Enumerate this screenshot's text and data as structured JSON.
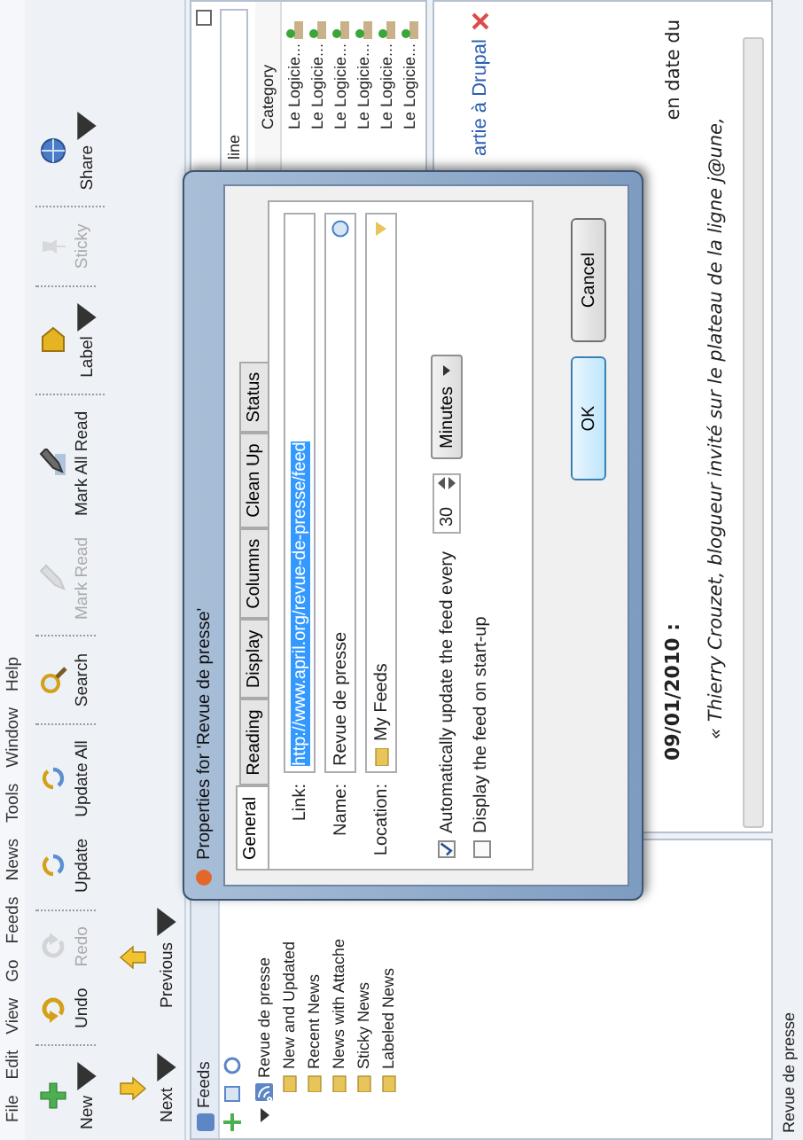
{
  "menu": [
    "File",
    "Edit",
    "View",
    "Go",
    "Feeds",
    "News",
    "Tools",
    "Window",
    "Help"
  ],
  "toolbar": {
    "items": [
      {
        "label": "New",
        "disabled": false,
        "dropdown": true,
        "separator_before": false
      },
      {
        "label": "Undo",
        "disabled": false,
        "dropdown": false,
        "separator_before": true
      },
      {
        "label": "Redo",
        "disabled": true,
        "dropdown": false,
        "separator_before": false
      },
      {
        "label": "Update",
        "disabled": false,
        "dropdown": false,
        "separator_before": true
      },
      {
        "label": "Update All",
        "disabled": false,
        "dropdown": false,
        "separator_before": false
      },
      {
        "label": "Search",
        "disabled": false,
        "dropdown": false,
        "separator_before": true
      },
      {
        "label": "Mark Read",
        "disabled": true,
        "dropdown": false,
        "separator_before": true
      },
      {
        "label": "Mark All Read",
        "disabled": false,
        "dropdown": false,
        "separator_before": false
      },
      {
        "label": "Label",
        "disabled": false,
        "dropdown": true,
        "separator_before": true
      },
      {
        "label": "Sticky",
        "disabled": true,
        "dropdown": false,
        "separator_before": true
      },
      {
        "label": "Share",
        "disabled": false,
        "dropdown": true,
        "separator_before": true
      }
    ],
    "navigation": [
      {
        "label": "Next",
        "dropdown": true
      },
      {
        "label": "Previous",
        "dropdown": true
      }
    ]
  },
  "feeds_panel": {
    "title": "Feeds",
    "tree": [
      {
        "label": "Revue de presse",
        "expanded": true,
        "children": [
          {
            "label": "New and Updated"
          },
          {
            "label": "Recent News"
          },
          {
            "label": "News with Attache"
          },
          {
            "label": "Sticky News"
          },
          {
            "label": "Labeled News"
          }
        ]
      }
    ]
  },
  "news": {
    "filter_text": "line",
    "columns": [
      "Category"
    ],
    "rows": [
      "Le Logicie...",
      "Le Logicie...",
      "Le Logicie...",
      "Le Logicie...",
      "Le Logicie...",
      "Le Logicie..."
    ]
  },
  "article": {
    "title": "artie à Drupal",
    "date": "09/01/2010 :",
    "date_tail": "en date du",
    "quote": "« Thierry Crouzet, blogueur invité sur le plateau de la ligne j@une,"
  },
  "dialog": {
    "title": "Properties for 'Revue de presse'",
    "tabs": [
      {
        "label": "General",
        "selected": true
      },
      {
        "label": "Reading",
        "selected": false
      },
      {
        "label": "Display",
        "selected": false
      },
      {
        "label": "Columns",
        "selected": false
      },
      {
        "label": "Clean Up",
        "selected": false
      },
      {
        "label": "Status",
        "selected": false
      }
    ],
    "link": {
      "label": "Link:",
      "value": "http://www.april.org/revue-de-presse/feed",
      "selected": true
    },
    "name": {
      "label": "Name:",
      "value": "Revue de presse"
    },
    "location": {
      "label": "Location:",
      "value": "My Feeds"
    },
    "auto_update": {
      "label": "Automatically update the feed every",
      "checked": true,
      "value": "30",
      "unit": "Minutes"
    },
    "startup": {
      "label": "Display the feed on start-up",
      "checked": false
    },
    "buttons": [
      "OK",
      "Cancel"
    ]
  },
  "status_bar": "Revue de presse"
}
